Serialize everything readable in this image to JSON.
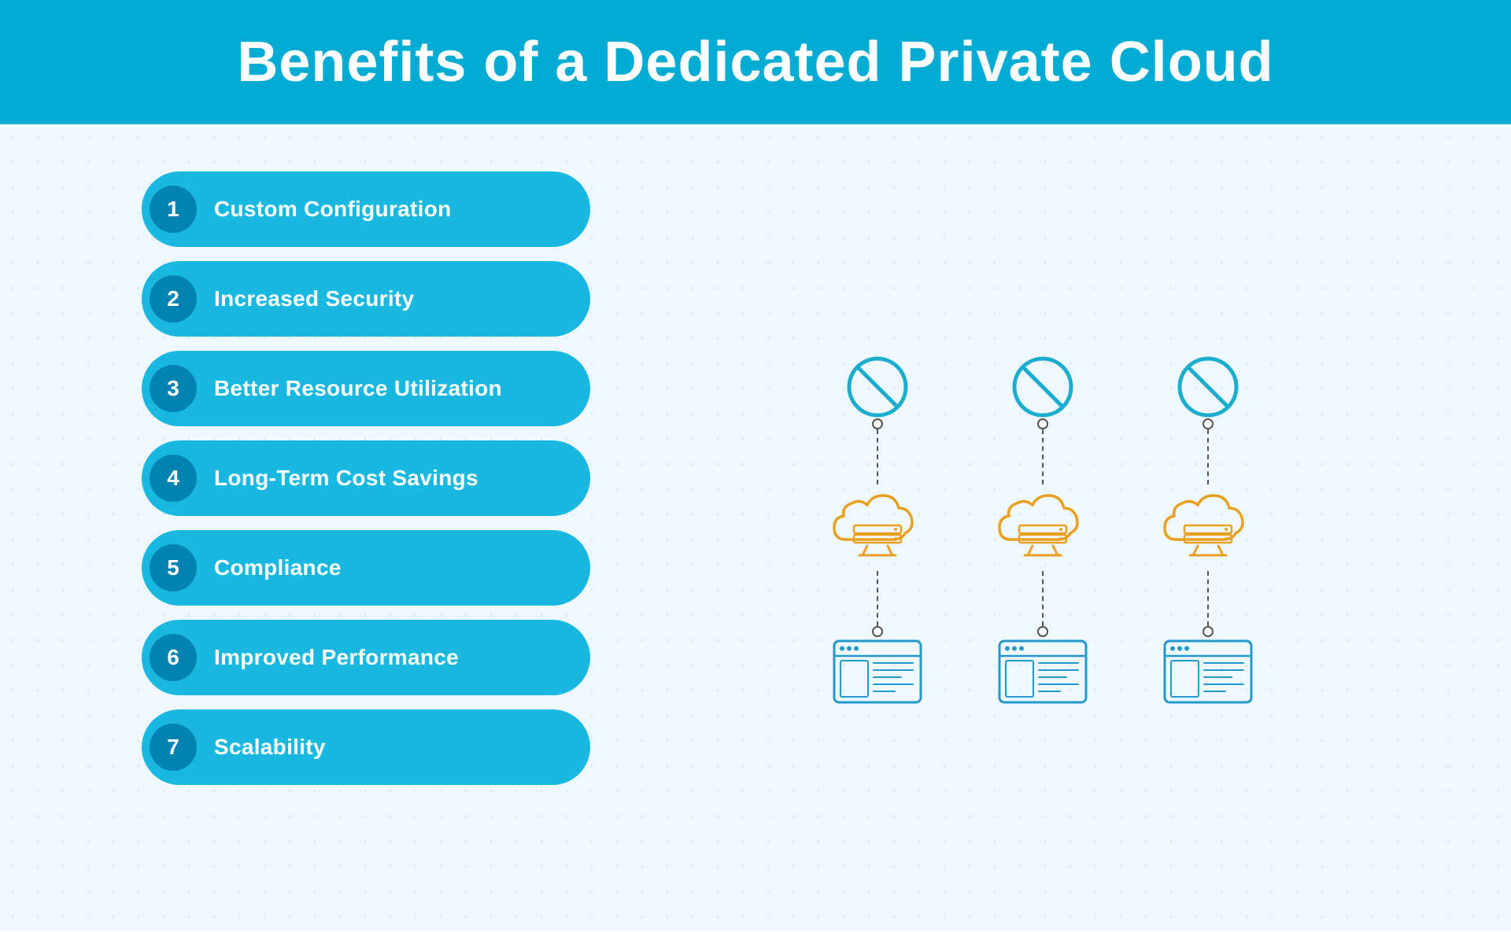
{
  "header": {
    "title": "Benefits of a Dedicated Private Cloud"
  },
  "benefits": [
    {
      "number": "1",
      "label": "Custom Configuration"
    },
    {
      "number": "2",
      "label": "Increased Security"
    },
    {
      "number": "3",
      "label": "Better Resource Utilization"
    },
    {
      "number": "4",
      "label": "Long-Term Cost Savings"
    },
    {
      "number": "5",
      "label": "Compliance"
    },
    {
      "number": "6",
      "label": "Improved Performance"
    },
    {
      "number": "7",
      "label": "Scalability"
    }
  ],
  "colors": {
    "header_bg": "#00acd4",
    "item_bg": "#18b8e0",
    "number_bg": "#0083b0",
    "cloud_orange": "#e8a020",
    "monitor_blue": "#2299cc",
    "block_blue": "#1aadce"
  }
}
